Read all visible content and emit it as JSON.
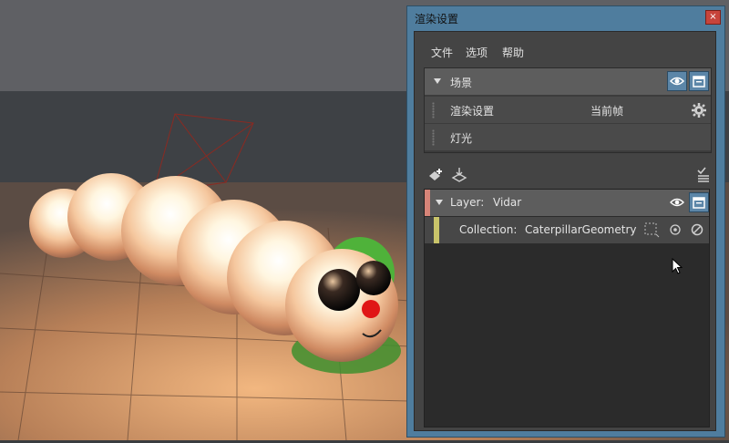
{
  "window": {
    "title": "渲染设置",
    "close_label": "×"
  },
  "menu": [
    "文件",
    "选项",
    "帮助"
  ],
  "scene_section": {
    "header": "场景",
    "rows": [
      {
        "label": "渲染设置",
        "value": "当前帧"
      },
      {
        "label": "灯光"
      }
    ]
  },
  "layers": {
    "layer": {
      "prefix": "Layer:",
      "name": "Vidar"
    },
    "collection": {
      "prefix": "Collection:",
      "name": "CaterpillarGeometry"
    }
  },
  "colors": {
    "window_accent": "#4f7d9e",
    "layer_marker": "#d68478",
    "collection_marker": "#c9c46a",
    "icon_selected": "#5c86a8"
  },
  "icons": [
    "close-icon",
    "eye-icon",
    "clapboard-icon",
    "gear-icon",
    "add-layer-icon",
    "import-layer-icon",
    "checklist-icon",
    "isolate-icon",
    "disable-icon",
    "selection-icon",
    "cursor-icon"
  ]
}
